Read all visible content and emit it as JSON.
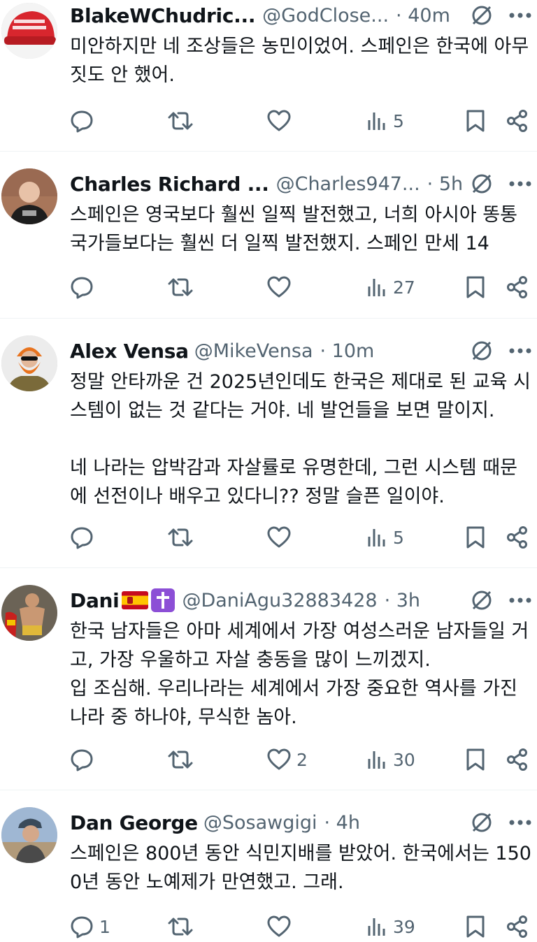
{
  "tweets": [
    {
      "name": "BlakeWChudric...",
      "handle": "@GodClose...",
      "time": "· 40m",
      "text": "미안하지만 네 조상들은 농민이었어. 스페인은 한국에 아무 짓도 안 했어.",
      "replies": "",
      "retweets": "",
      "likes": "",
      "views": "5",
      "avatar_desc": "red cap"
    },
    {
      "name": "Charles Richard ...",
      "handle": "@Charles947...",
      "time": "· 5h",
      "text": "스페인은 영국보다 훨씬 일찍 발전했고, 너희 아시아 똥통 국가들보다는 훨씬 더 일찍 발전했지. 스페인 만세 14",
      "replies": "",
      "retweets": "",
      "likes": "",
      "views": "27",
      "avatar_desc": "man in black shirt"
    },
    {
      "name": "Alex Vensa",
      "handle": "@MikeVensa",
      "time": "· 10m",
      "text": "정말 안타까운 건 2025년인데도 한국은 제대로 된 교육 시스템이 없는 것 같다는 거야. 네 발언들을 보면 말이지.\n\n네 나라는 압박감과 자살률로 유명한데, 그런 시스템 때문에 선전이나 배우고 있다니?? 정말 슬픈 일이야.",
      "replies": "",
      "retweets": "",
      "likes": "",
      "views": "5",
      "avatar_desc": "orange beard character"
    },
    {
      "name": "Dani",
      "handle": "@DaniAgu32883428",
      "time": "· 3h",
      "text": "한국 남자들은 아마 세계에서 가장 여성스러운 남자들일 거고, 가장 우울하고 자살 충동을 많이 느끼겠지.\n입 조심해. 우리나라는 세계에서 가장 중요한 역사를 가진 나라 중 하나야, 무식한 놈아.",
      "replies": "",
      "retweets": "",
      "likes": "2",
      "views": "30",
      "avatar_desc": "fighter"
    },
    {
      "name": "Dan George",
      "handle": "@Sosawgigi",
      "time": "· 4h",
      "text": "스페인은 800년 동안 식민지배를 받았어. 한국에서는 1500년 동안 노예제가 만연했고. 그래.",
      "replies": "1",
      "retweets": "",
      "likes": "",
      "views": "39",
      "avatar_desc": "man with cap outdoors"
    }
  ],
  "icons": {
    "grok": "grok-icon",
    "more": "more-icon",
    "reply": "reply-icon",
    "retweet": "retweet-icon",
    "like": "like-icon",
    "views": "views-icon",
    "bookmark": "bookmark-icon",
    "share": "share-icon"
  },
  "colors": {
    "secondary": "#536471",
    "border": "#eff3f4",
    "text": "#0f1419"
  }
}
